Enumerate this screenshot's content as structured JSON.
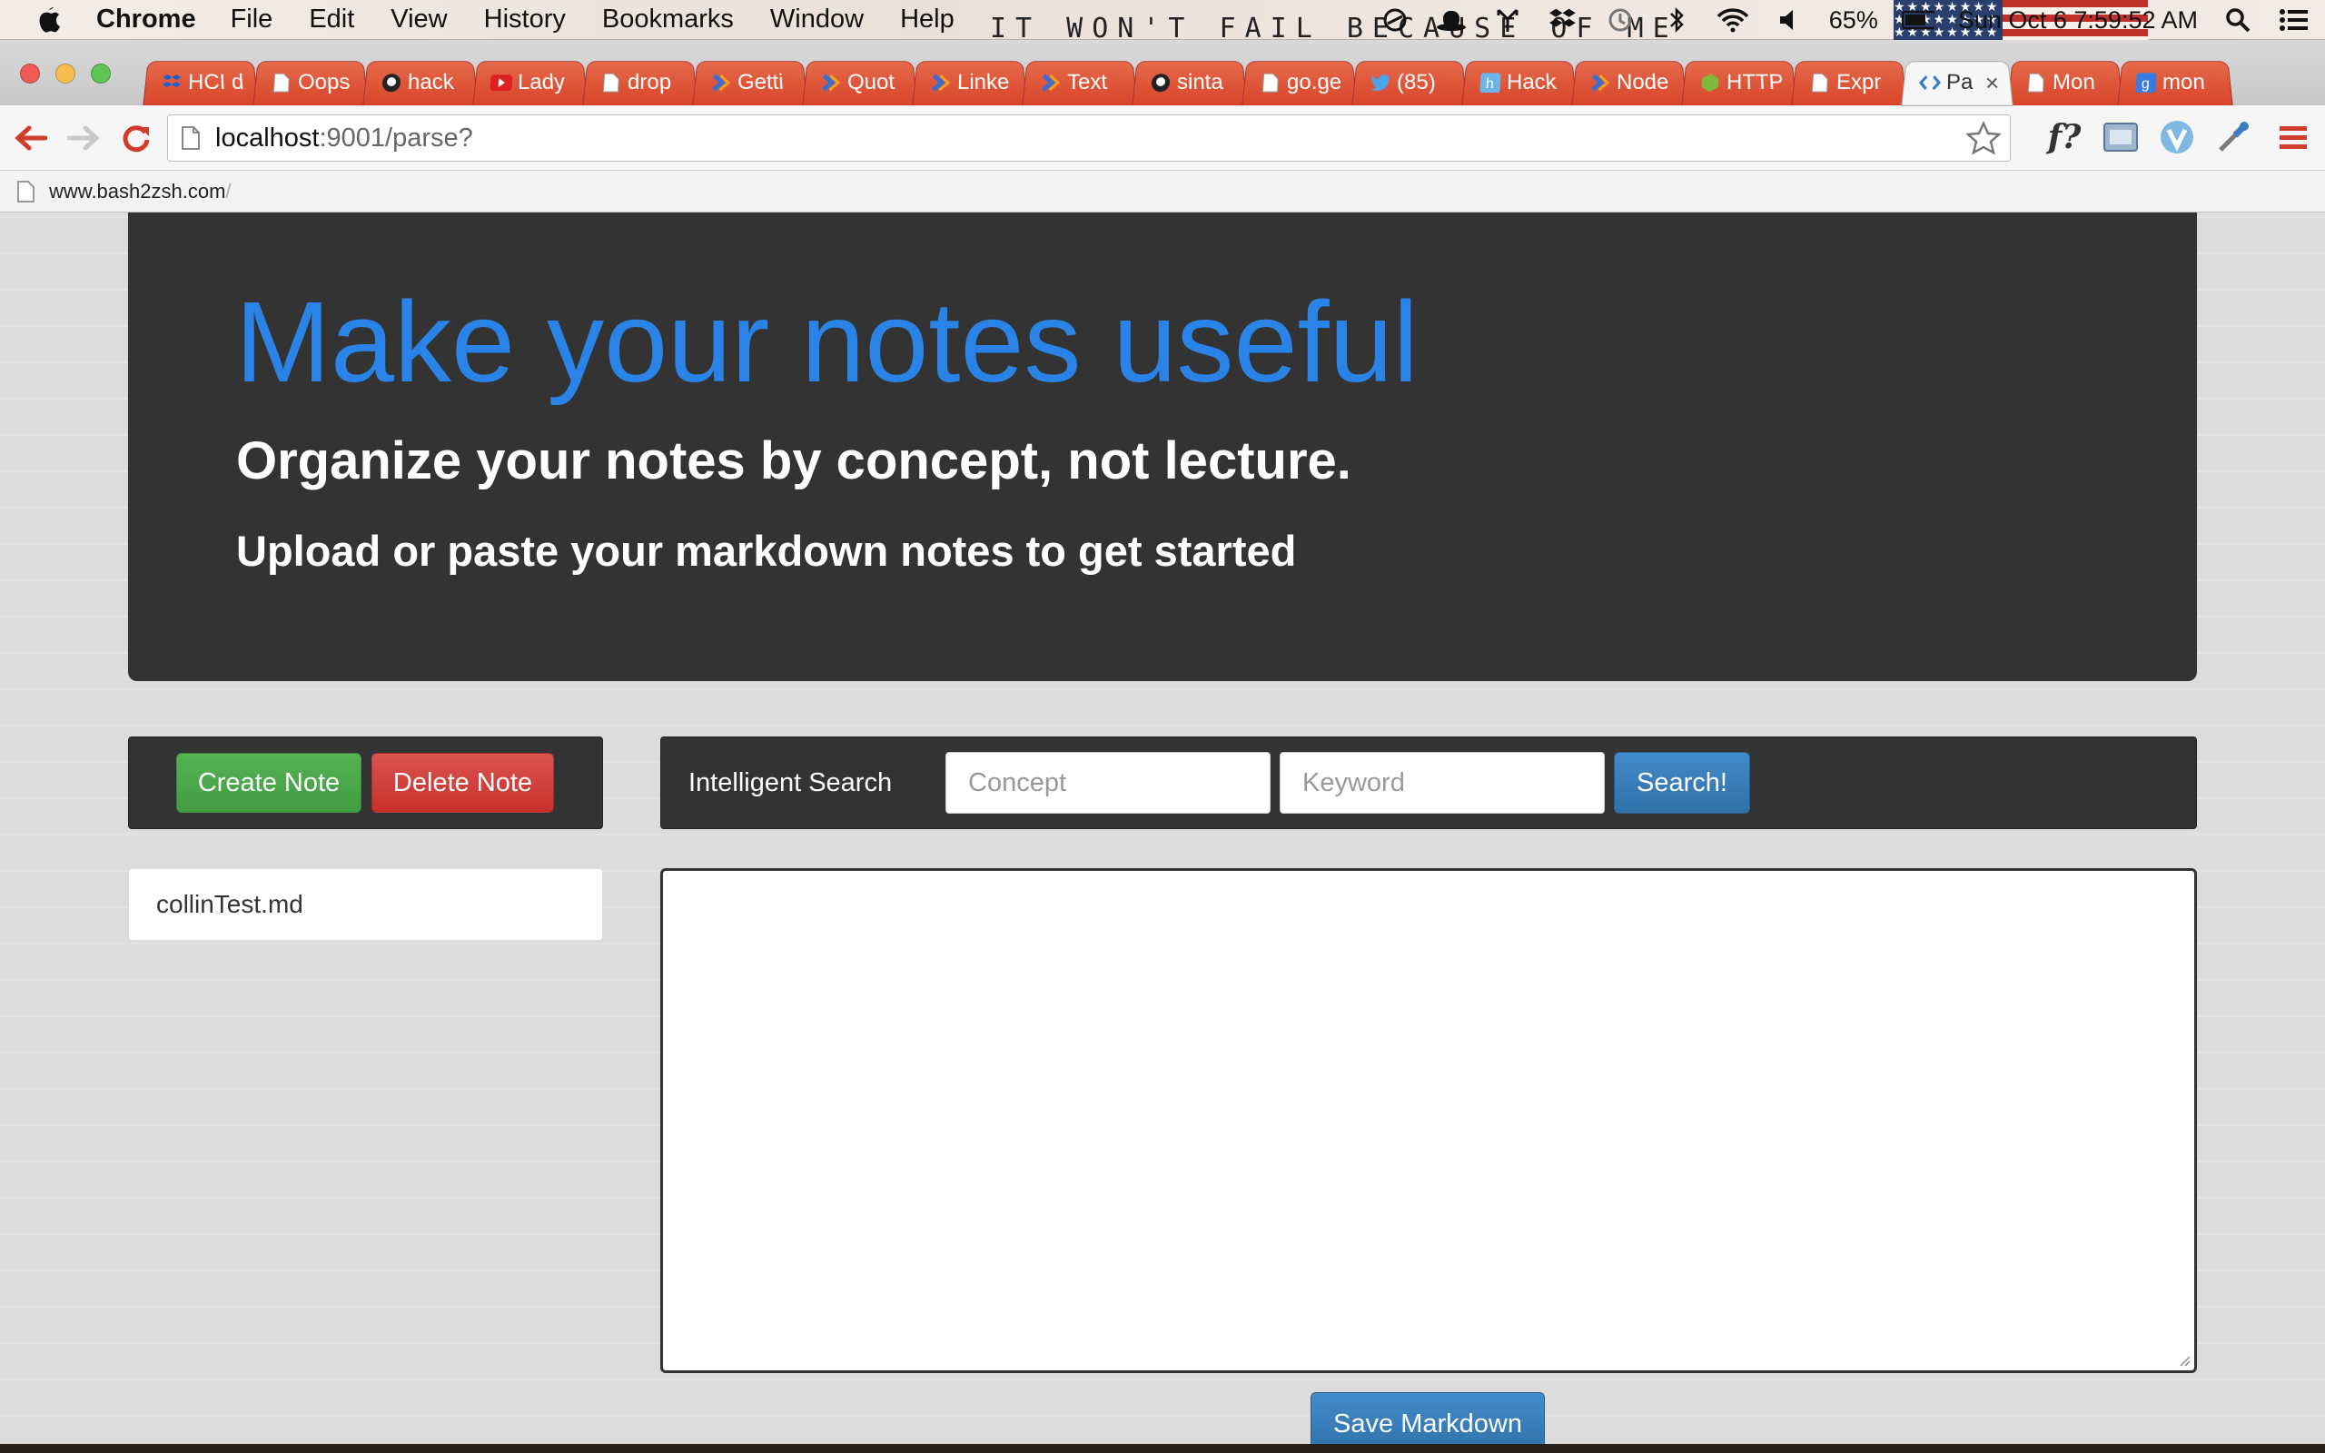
{
  "menubar": {
    "app": "Chrome",
    "items": [
      "File",
      "Edit",
      "View",
      "History",
      "Bookmarks",
      "Window",
      "Help"
    ],
    "wallpaper_text": "IT  WON'T FAIL  BECAUSE OF ME",
    "battery": "65%",
    "clock": "Sun Oct 6  7:59:52 AM"
  },
  "tabs": [
    {
      "label": "HCI d",
      "icon": "dropbox-icon"
    },
    {
      "label": "Oops",
      "icon": "page-icon"
    },
    {
      "label": "hack",
      "icon": "github-icon"
    },
    {
      "label": "Lady",
      "icon": "youtube-icon"
    },
    {
      "label": "drop",
      "icon": "page-icon"
    },
    {
      "label": "Getti",
      "icon": "chevron-icon"
    },
    {
      "label": "Quot",
      "icon": "chevron-icon"
    },
    {
      "label": "Linke",
      "icon": "chevron-icon"
    },
    {
      "label": "Text",
      "icon": "chevron-icon"
    },
    {
      "label": "sinta",
      "icon": "github-icon"
    },
    {
      "label": "go.ge",
      "icon": "page-icon"
    },
    {
      "label": "(85)",
      "icon": "twitter-icon"
    },
    {
      "label": "Hack",
      "icon": "h-icon"
    },
    {
      "label": "Node",
      "icon": "chevron-icon"
    },
    {
      "label": "HTTP",
      "icon": "hexagon-icon"
    },
    {
      "label": "Expr",
      "icon": "page-icon"
    },
    {
      "label": "Pa",
      "icon": "code-icon",
      "active": true
    },
    {
      "label": "Mon",
      "icon": "page-icon"
    },
    {
      "label": "mon",
      "icon": "google-icon"
    }
  ],
  "toolbar": {
    "url_host": "localhost",
    "url_path": ":9001/parse?"
  },
  "bookmarks": {
    "item": "www.bash2zsh.com",
    "suffix": "/"
  },
  "hero": {
    "title": "Make your notes useful",
    "subtitle": "Organize your notes by concept, not lecture.",
    "tagline": "Upload or paste your markdown notes to get started"
  },
  "actions": {
    "create_label": "Create Note",
    "delete_label": "Delete Note"
  },
  "search": {
    "label": "Intelligent Search",
    "concept_placeholder": "Concept",
    "keyword_placeholder": "Keyword",
    "button_label": "Search!"
  },
  "notes": [
    {
      "name": "collinTest.md"
    }
  ],
  "editor": {
    "content": "",
    "save_label": "Save Markdown"
  },
  "colors": {
    "hero_title": "#2a84e8",
    "panel_bg": "#333333",
    "create_btn": "#449d44",
    "delete_btn": "#c9302c",
    "primary_btn": "#3071a9",
    "tab_bg": "#d8452b"
  }
}
